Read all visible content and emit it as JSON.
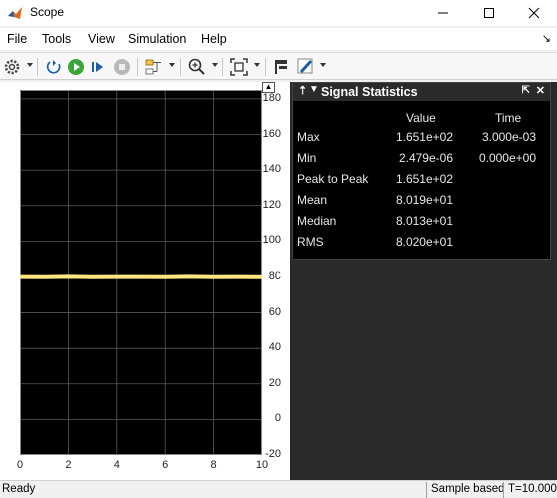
{
  "window": {
    "title": "Scope"
  },
  "menu": [
    "File",
    "Tools",
    "View",
    "Simulation",
    "Help"
  ],
  "stats": {
    "title": "Signal Statistics",
    "col_value": "Value",
    "col_time": "Time",
    "rows": [
      {
        "label": "Max",
        "value": "1.651e+02",
        "time": "3.000e-03"
      },
      {
        "label": "Min",
        "value": "2.479e-06",
        "time": "0.000e+00"
      },
      {
        "label": "Peak to Peak",
        "value": "1.651e+02",
        "time": ""
      },
      {
        "label": "Mean",
        "value": "8.019e+01",
        "time": ""
      },
      {
        "label": "Median",
        "value": "8.013e+01",
        "time": ""
      },
      {
        "label": "RMS",
        "value": "8.020e+01",
        "time": ""
      }
    ]
  },
  "status": {
    "left": "Ready",
    "mode": "Sample based",
    "time": "T=10.000"
  },
  "colors": {
    "plot_bg": "#000000",
    "signal": "#ffe680",
    "grid": "#5a5a5a"
  },
  "icons": [
    "matlab-icon",
    "settings-icon",
    "step-back-icon",
    "run-icon",
    "step-forward-icon",
    "stop-icon",
    "signal-select-icon",
    "zoom-icon",
    "fit-to-view-icon",
    "cursor-icon",
    "highlight-icon"
  ],
  "chart_data": {
    "type": "line",
    "x": [
      0,
      1,
      2,
      3,
      4,
      5,
      6,
      7,
      8,
      9,
      10
    ],
    "series": [
      {
        "values": [
          80.2,
          80.1,
          80.3,
          80.1,
          80.2,
          80.2,
          80.1,
          80.3,
          80.1,
          80.2,
          80.1
        ]
      }
    ],
    "xlim": [
      0,
      10
    ],
    "ylim": [
      -20,
      185
    ],
    "xticks": [
      "0",
      "2",
      "4",
      "6",
      "8",
      "10"
    ],
    "yticks": [
      "-20",
      "0",
      "20",
      "40",
      "60",
      "80",
      "100",
      "120",
      "140",
      "160",
      "180"
    ],
    "xtick_values": [
      0,
      2,
      4,
      6,
      8,
      10
    ],
    "ytick_values": [
      -20,
      0,
      20,
      40,
      60,
      80,
      100,
      120,
      140,
      160,
      180
    ],
    "grid": true
  }
}
